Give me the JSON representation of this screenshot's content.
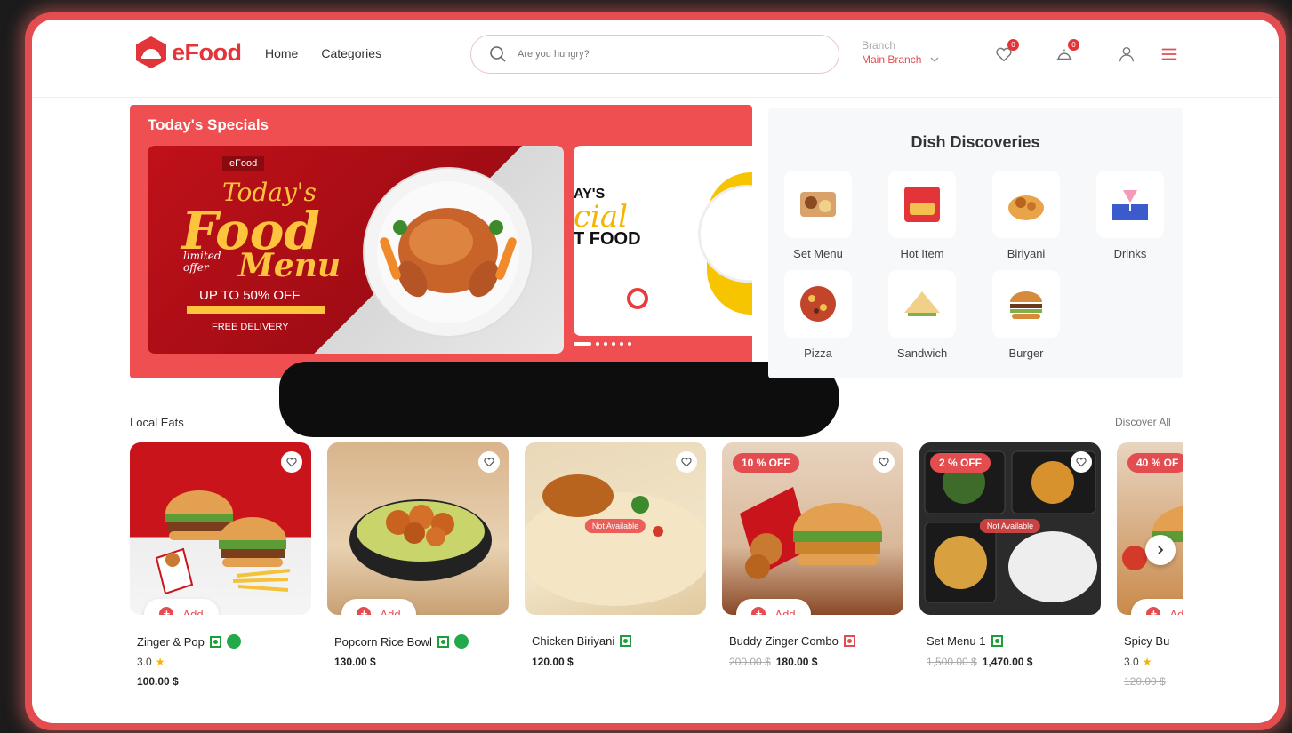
{
  "header": {
    "logo_text": "eFood",
    "nav": [
      "Home",
      "Categories"
    ],
    "search_placeholder": "Are you hungry?",
    "branch_label": "Branch",
    "branch_value": "Main Branch",
    "wishlist_count": "0",
    "cart_count": "0"
  },
  "specials": {
    "title": "Today's Specials",
    "banner1": {
      "brand": "eFood",
      "line1": "Today's",
      "line2": "Food",
      "line3": "limited offer",
      "line4": "Menu",
      "offer": "UP TO 50% OFF",
      "delivery": "FREE DELIVERY"
    },
    "banner2": {
      "line1": "AY'S",
      "line2": "cial",
      "line3": "T FOOD"
    }
  },
  "discoveries": {
    "title": "Dish Discoveries",
    "items": [
      "Set Menu",
      "Hot Item",
      "Biriyani",
      "Drinks",
      "Pizza",
      "Sandwich",
      "Burger"
    ]
  },
  "local": {
    "title": "Local Eats",
    "discover_all": "Discover All",
    "add_label": "Add",
    "not_available": "Not Available",
    "cards": [
      {
        "name": "Zinger & Pop",
        "rating": "3.0",
        "price": "100.00 $",
        "old_price": "",
        "off": ""
      },
      {
        "name": "Popcorn Rice Bowl",
        "rating": "",
        "price": "130.00 $",
        "old_price": "",
        "off": ""
      },
      {
        "name": "Chicken Biriyani",
        "rating": "",
        "price": "120.00 $",
        "old_price": "",
        "off": ""
      },
      {
        "name": "Buddy Zinger Combo",
        "rating": "",
        "price": "180.00 $",
        "old_price": "200.00 $",
        "off": "10 % OFF"
      },
      {
        "name": "Set Menu 1",
        "rating": "",
        "price": "1,470.00 $",
        "old_price": "1,500.00 $",
        "off": "2 % OFF"
      },
      {
        "name": "Spicy Bu",
        "rating": "3.0",
        "price": "",
        "old_price": "120.00 $",
        "off": "40 % OF"
      }
    ]
  },
  "colors": {
    "brand": "#e34d50",
    "veg": "#1f9d3a"
  }
}
